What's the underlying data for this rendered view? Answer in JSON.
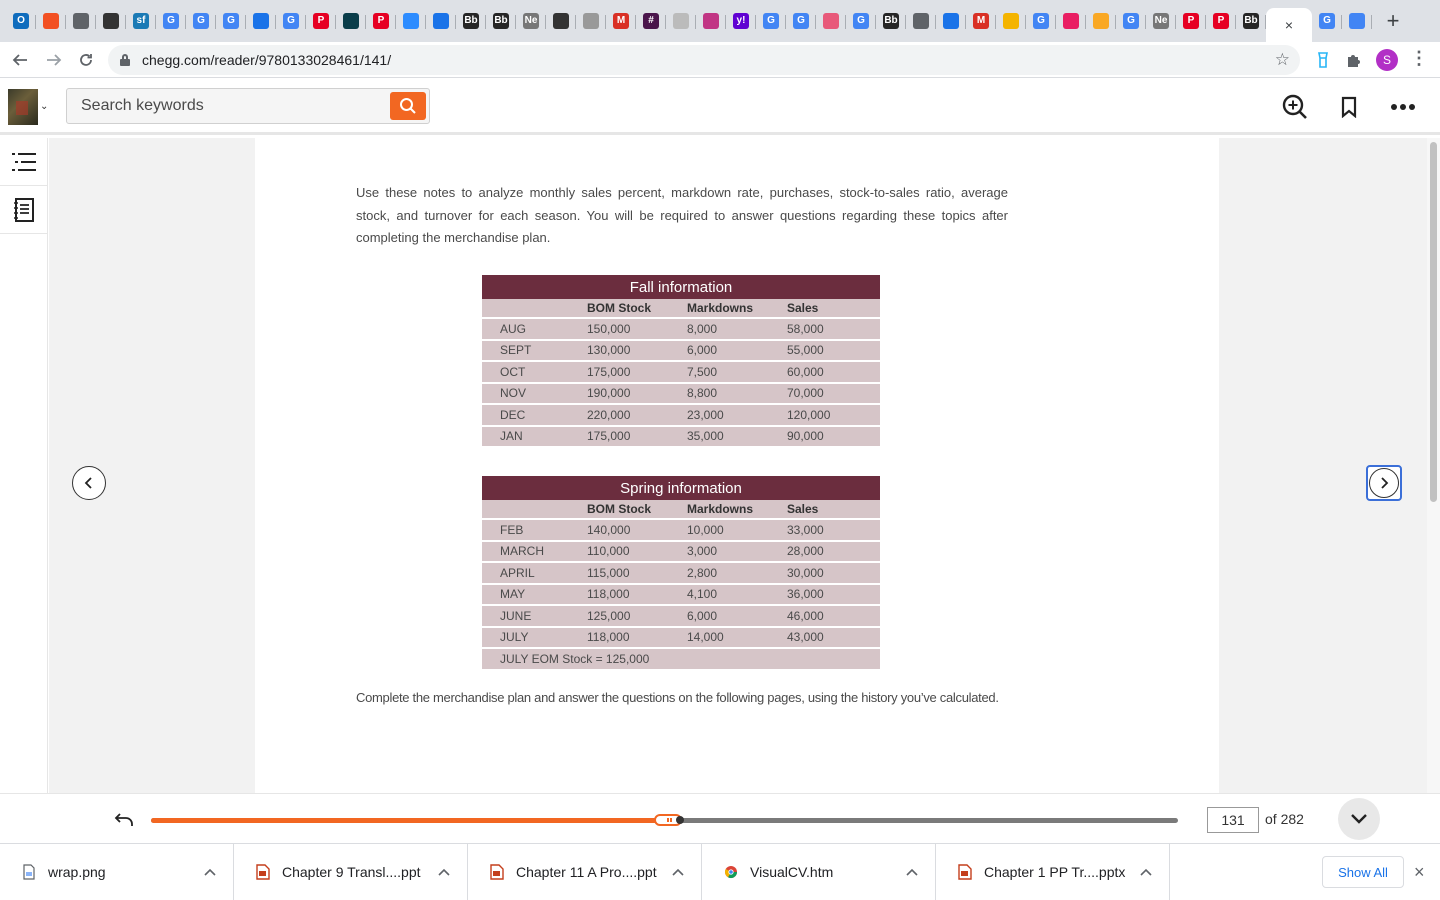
{
  "browser": {
    "tab_icons": [
      {
        "icon": "outlook-icon",
        "text": "O",
        "color": "#0f6cbd"
      },
      {
        "icon": "microsoft-icon",
        "text": "",
        "color": "#f25022"
      },
      {
        "icon": "globe-icon",
        "text": "",
        "color": "#5f6368"
      },
      {
        "icon": "runner-icon",
        "text": "",
        "color": "#333333"
      },
      {
        "icon": "sf-icon",
        "text": "sf",
        "color": "#1b7ab5"
      },
      {
        "icon": "google-icon",
        "text": "G",
        "color": "#4285f4"
      },
      {
        "icon": "google-icon",
        "text": "G",
        "color": "#4285f4"
      },
      {
        "icon": "google-icon",
        "text": "G",
        "color": "#4285f4"
      },
      {
        "icon": "filter-icon",
        "text": "",
        "color": "#1a73e8"
      },
      {
        "icon": "google-icon",
        "text": "G",
        "color": "#4285f4"
      },
      {
        "icon": "pinterest-icon",
        "text": "P",
        "color": "#e60023"
      },
      {
        "icon": "book-icon",
        "text": "",
        "color": "#0a3d4a"
      },
      {
        "icon": "pinterest-icon",
        "text": "P",
        "color": "#e60023"
      },
      {
        "icon": "zoom-icon",
        "text": "",
        "color": "#2d8cff"
      },
      {
        "icon": "filter-icon",
        "text": "",
        "color": "#1a73e8"
      },
      {
        "icon": "blackboard-icon",
        "text": "Bb",
        "color": "#262626"
      },
      {
        "icon": "blackboard-icon",
        "text": "Bb",
        "color": "#262626"
      },
      {
        "icon": "news-icon",
        "text": "Ne",
        "color": "#777777"
      },
      {
        "icon": "circle-icon",
        "text": "",
        "color": "#333333"
      },
      {
        "icon": "chart-icon",
        "text": "",
        "color": "#999999"
      },
      {
        "icon": "gmail-icon",
        "text": "M",
        "color": "#d93025"
      },
      {
        "icon": "slack-icon",
        "text": "#",
        "color": "#4a154b"
      },
      {
        "icon": "page-icon",
        "text": "",
        "color": "#bbbbbb"
      },
      {
        "icon": "instagram-icon",
        "text": "",
        "color": "#c13584"
      },
      {
        "icon": "yahoo-icon",
        "text": "y!",
        "color": "#6001d2"
      },
      {
        "icon": "google-icon",
        "text": "G",
        "color": "#4285f4"
      },
      {
        "icon": "google-icon",
        "text": "G",
        "color": "#4285f4"
      },
      {
        "icon": "target-icon",
        "text": "",
        "color": "#e8597a"
      },
      {
        "icon": "google-icon",
        "text": "G",
        "color": "#4285f4"
      },
      {
        "icon": "blackboard-icon",
        "text": "Bb",
        "color": "#262626"
      },
      {
        "icon": "globe-icon",
        "text": "",
        "color": "#5f6368"
      },
      {
        "icon": "filter-icon",
        "text": "",
        "color": "#1a73e8"
      },
      {
        "icon": "gmail-icon",
        "text": "M",
        "color": "#d93025"
      },
      {
        "icon": "slides-icon",
        "text": "",
        "color": "#f4b400"
      },
      {
        "icon": "google-icon",
        "text": "G",
        "color": "#4285f4"
      },
      {
        "icon": "app-icon",
        "text": "",
        "color": "#e91e63"
      },
      {
        "icon": "app-icon",
        "text": "",
        "color": "#f9a825"
      },
      {
        "icon": "google-icon",
        "text": "G",
        "color": "#4285f4"
      },
      {
        "icon": "news-icon",
        "text": "Ne",
        "color": "#777777"
      },
      {
        "icon": "pinterest-icon",
        "text": "P",
        "color": "#e60023"
      },
      {
        "icon": "pinterest-icon",
        "text": "P",
        "color": "#e60023"
      },
      {
        "icon": "blackboard-icon",
        "text": "Bb",
        "color": "#262626"
      }
    ],
    "tab_icons_after": [
      {
        "icon": "google-icon",
        "text": "G",
        "color": "#4285f4"
      },
      {
        "icon": "docs-icon",
        "text": "",
        "color": "#4285f4"
      }
    ],
    "active_tab_close": "×",
    "new_tab": "+",
    "url": "chegg.com/reader/9780133028461/141/",
    "profile_initial": "S"
  },
  "reader": {
    "search_placeholder": "Search keywords",
    "intro_text": "Use these notes to analyze monthly sales percent, markdown rate, purchases, stock-to-sales ratio, average stock, and turnover for each season. You will be required to answer questions regarding these topics after completing the merchandise plan.",
    "fall_table": {
      "title": "Fall information",
      "headers": [
        "",
        "BOM Stock",
        "Markdowns",
        "Sales"
      ],
      "rows": [
        [
          "AUG",
          "150,000",
          "8,000",
          "58,000"
        ],
        [
          "SEPT",
          "130,000",
          "6,000",
          "55,000"
        ],
        [
          "OCT",
          "175,000",
          "7,500",
          "60,000"
        ],
        [
          "NOV",
          "190,000",
          "8,800",
          "70,000"
        ],
        [
          "DEC",
          "220,000",
          "23,000",
          "120,000"
        ],
        [
          "JAN",
          "175,000",
          "35,000",
          "90,000"
        ]
      ]
    },
    "spring_table": {
      "title": "Spring information",
      "headers": [
        "",
        "BOM Stock",
        "Markdowns",
        "Sales"
      ],
      "rows": [
        [
          "FEB",
          "140,000",
          "10,000",
          "33,000"
        ],
        [
          "MARCH",
          "110,000",
          "3,000",
          "28,000"
        ],
        [
          "APRIL",
          "115,000",
          "2,800",
          "30,000"
        ],
        [
          "MAY",
          "118,000",
          "4,100",
          "36,000"
        ],
        [
          "JUNE",
          "125,000",
          "6,000",
          "46,000"
        ],
        [
          "JULY",
          "118,000",
          "14,000",
          "43,000"
        ]
      ],
      "footer": "JULY EOM Stock = 125,000"
    },
    "outro_text": "Complete the merchandise plan and answer the questions on the following pages, using the history you’ve calculated."
  },
  "progress": {
    "current_page": "131",
    "total_label": "of 282",
    "fraction": 0.503,
    "fill_color": "#f26722"
  },
  "downloads": {
    "items": [
      {
        "name": "wrap.png",
        "icon": "image-file-icon"
      },
      {
        "name": "Chapter 9 Transl....ppt",
        "icon": "ppt-file-icon"
      },
      {
        "name": "Chapter 11 A Pro....ppt",
        "icon": "ppt-file-icon"
      },
      {
        "name": "VisualCV.htm",
        "icon": "chrome-file-icon"
      },
      {
        "name": "Chapter 1  PP Tr....pptx",
        "icon": "ppt-file-icon"
      }
    ],
    "show_all": "Show All",
    "close": "×"
  }
}
